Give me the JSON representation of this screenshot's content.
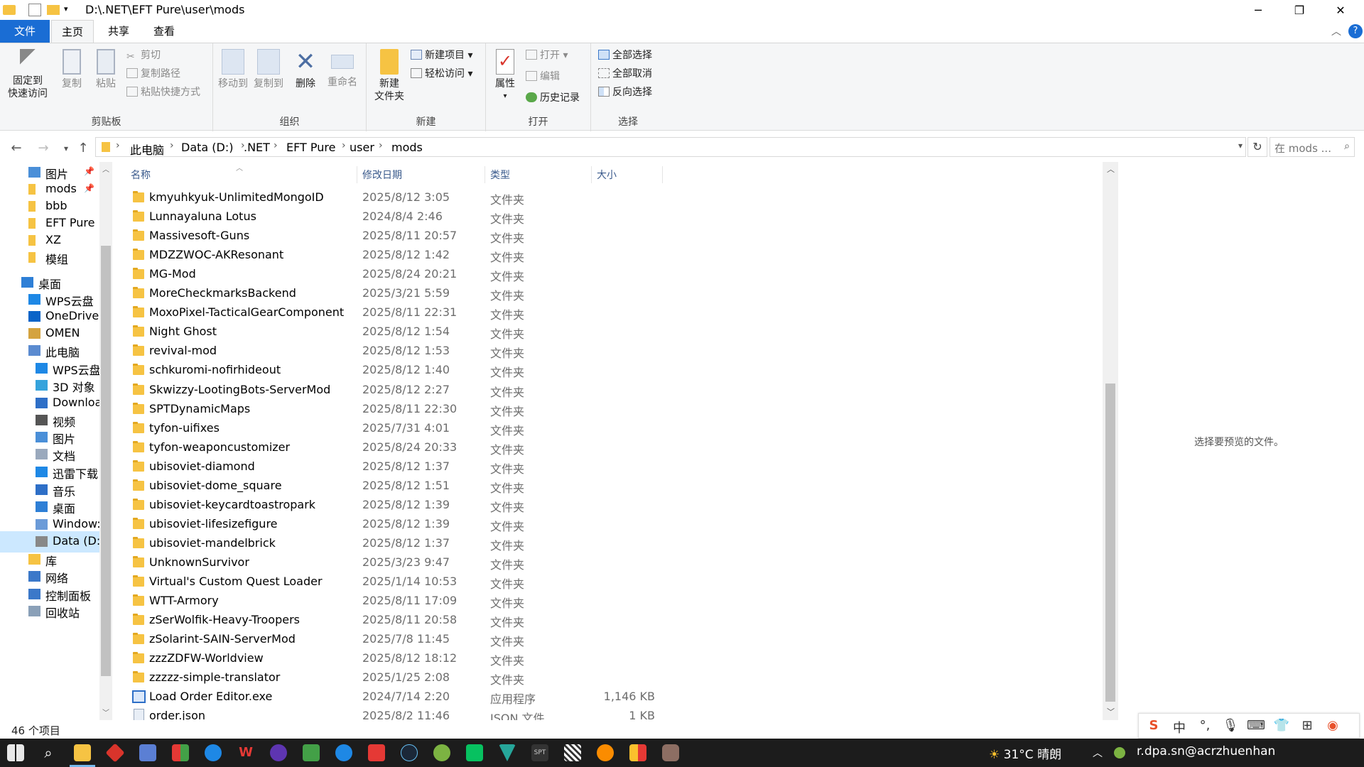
{
  "window": {
    "title_path": "D:\\.NET\\EFT Pure\\user\\mods"
  },
  "ribbon_tabs": [
    {
      "label": "文件"
    },
    {
      "label": "主页"
    },
    {
      "label": "共享"
    },
    {
      "label": "查看"
    }
  ],
  "ribbon": {
    "clipboard": {
      "pin_line1": "固定到",
      "pin_line2": "快速访问",
      "copy": "复制",
      "paste": "粘贴",
      "cut": "剪切",
      "copy_path": "复制路径",
      "paste_shortcut": "粘贴快捷方式",
      "group": "剪贴板"
    },
    "organize": {
      "move_to": "移动到",
      "copy_to": "复制到",
      "delete": "删除",
      "rename": "重命名",
      "group": "组织"
    },
    "new": {
      "new_folder_line1": "新建",
      "new_folder_line2": "文件夹",
      "new_item": "新建项目",
      "easy_access": "轻松访问",
      "group": "新建"
    },
    "open": {
      "properties": "属性",
      "open": "打开",
      "edit": "编辑",
      "history": "历史记录",
      "group": "打开"
    },
    "select": {
      "select_all": "全部选择",
      "select_none": "全部取消",
      "invert": "反向选择",
      "group": "选择"
    }
  },
  "address": {
    "crumbs": [
      "此电脑",
      "Data (D:)",
      ".NET",
      "EFT Pure",
      "user",
      "mods"
    ],
    "search_placeholder": "在 mods ..."
  },
  "nav": [
    {
      "label": "图片",
      "icon": "pictures-icon",
      "pinned": true
    },
    {
      "label": "mods",
      "icon": "folder-icon",
      "pinned": true
    },
    {
      "label": "bbb",
      "icon": "folder-icon"
    },
    {
      "label": "EFT Pure",
      "icon": "folder-icon"
    },
    {
      "label": "XZ",
      "icon": "folder-icon"
    },
    {
      "label": "模组",
      "icon": "folder-icon"
    },
    {
      "label": "桌面",
      "icon": "desktop-icon"
    },
    {
      "label": "WPS云盘",
      "icon": "cloud-icon"
    },
    {
      "label": "OneDrive",
      "icon": "onedrive-icon"
    },
    {
      "label": "OMEN",
      "icon": "user-icon"
    },
    {
      "label": "此电脑",
      "icon": "computer-icon"
    },
    {
      "label": "WPS云盘",
      "icon": "cloud-icon"
    },
    {
      "label": "3D 对象",
      "icon": "cube-icon"
    },
    {
      "label": "Downloa",
      "icon": "download-icon"
    },
    {
      "label": "视频",
      "icon": "video-icon"
    },
    {
      "label": "图片",
      "icon": "pictures-icon"
    },
    {
      "label": "文档",
      "icon": "document-icon"
    },
    {
      "label": "迅雷下载",
      "icon": "thunder-icon"
    },
    {
      "label": "音乐",
      "icon": "music-icon"
    },
    {
      "label": "桌面",
      "icon": "desktop-icon"
    },
    {
      "label": "Window:",
      "icon": "windows-drive-icon"
    },
    {
      "label": "Data (D:)",
      "icon": "drive-icon",
      "selected": true
    },
    {
      "label": "库",
      "icon": "library-icon"
    },
    {
      "label": "网络",
      "icon": "network-icon"
    },
    {
      "label": "控制面板",
      "icon": "control-panel-icon"
    },
    {
      "label": "回收站",
      "icon": "recycle-bin-icon"
    }
  ],
  "columns": {
    "name": "名称",
    "date": "修改日期",
    "type": "类型",
    "size": "大小"
  },
  "files": [
    {
      "name": "kmyuhkyuk-UnlimitedMongoID",
      "date": "2025/8/12 3:05",
      "type": "文件夹",
      "size": ""
    },
    {
      "name": "Lunnayaluna Lotus",
      "date": "2024/8/4 2:46",
      "type": "文件夹",
      "size": ""
    },
    {
      "name": "Massivesoft-Guns",
      "date": "2025/8/11 20:57",
      "type": "文件夹",
      "size": ""
    },
    {
      "name": "MDZZWOC-AKResonant",
      "date": "2025/8/12 1:42",
      "type": "文件夹",
      "size": ""
    },
    {
      "name": "MG-Mod",
      "date": "2025/8/24 20:21",
      "type": "文件夹",
      "size": ""
    },
    {
      "name": "MoreCheckmarksBackend",
      "date": "2025/3/21 5:59",
      "type": "文件夹",
      "size": ""
    },
    {
      "name": "MoxoPixel-TacticalGearComponent",
      "date": "2025/8/11 22:31",
      "type": "文件夹",
      "size": ""
    },
    {
      "name": "Night Ghost",
      "date": "2025/8/12 1:54",
      "type": "文件夹",
      "size": ""
    },
    {
      "name": "revival-mod",
      "date": "2025/8/12 1:53",
      "type": "文件夹",
      "size": ""
    },
    {
      "name": "schkuromi-nofirhideout",
      "date": "2025/8/12 1:40",
      "type": "文件夹",
      "size": ""
    },
    {
      "name": "Skwizzy-LootingBots-ServerMod",
      "date": "2025/8/12 2:27",
      "type": "文件夹",
      "size": ""
    },
    {
      "name": "SPTDynamicMaps",
      "date": "2025/8/11 22:30",
      "type": "文件夹",
      "size": ""
    },
    {
      "name": "tyfon-uifixes",
      "date": "2025/7/31 4:01",
      "type": "文件夹",
      "size": ""
    },
    {
      "name": "tyfon-weaponcustomizer",
      "date": "2025/8/24 20:33",
      "type": "文件夹",
      "size": ""
    },
    {
      "name": "ubisoviet-diamond",
      "date": "2025/8/12 1:37",
      "type": "文件夹",
      "size": ""
    },
    {
      "name": "ubisoviet-dome_square",
      "date": "2025/8/12 1:51",
      "type": "文件夹",
      "size": ""
    },
    {
      "name": "ubisoviet-keycardtoastropark",
      "date": "2025/8/12 1:39",
      "type": "文件夹",
      "size": ""
    },
    {
      "name": "ubisoviet-lifesizefigure",
      "date": "2025/8/12 1:39",
      "type": "文件夹",
      "size": ""
    },
    {
      "name": "ubisoviet-mandelbrick",
      "date": "2025/8/12 1:37",
      "type": "文件夹",
      "size": ""
    },
    {
      "name": "UnknownSurvivor",
      "date": "2025/3/23 9:47",
      "type": "文件夹",
      "size": ""
    },
    {
      "name": "Virtual's Custom Quest Loader",
      "date": "2025/1/14 10:53",
      "type": "文件夹",
      "size": ""
    },
    {
      "name": "WTT-Armory",
      "date": "2025/8/11 17:09",
      "type": "文件夹",
      "size": ""
    },
    {
      "name": "zSerWolfik-Heavy-Troopers",
      "date": "2025/8/11 20:58",
      "type": "文件夹",
      "size": ""
    },
    {
      "name": "zSolarint-SAIN-ServerMod",
      "date": "2025/7/8 11:45",
      "type": "文件夹",
      "size": ""
    },
    {
      "name": "zzzZDFW-Worldview",
      "date": "2025/8/12 18:12",
      "type": "文件夹",
      "size": ""
    },
    {
      "name": "zzzzz-simple-translator",
      "date": "2025/1/25 2:08",
      "type": "文件夹",
      "size": ""
    },
    {
      "name": "Load Order Editor.exe",
      "date": "2024/7/14 2:20",
      "type": "应用程序",
      "size": "1,146 KB",
      "kind": "exe"
    },
    {
      "name": "order.json",
      "date": "2025/8/2 11:46",
      "type": "JSON 文件",
      "size": "1 KB",
      "kind": "json"
    }
  ],
  "preview": {
    "text": "选择要预览的文件。"
  },
  "status": {
    "count": "46 个项目"
  },
  "ime": {
    "lang": "中"
  },
  "taskbar": {
    "weather_temp": "31°C",
    "weather_text": "晴朗",
    "tray_text": "r.dpa.sn@acrzhuenhan",
    "colors": {
      "bg": "#1c1c1c",
      "accent": "#76b9ed"
    }
  }
}
